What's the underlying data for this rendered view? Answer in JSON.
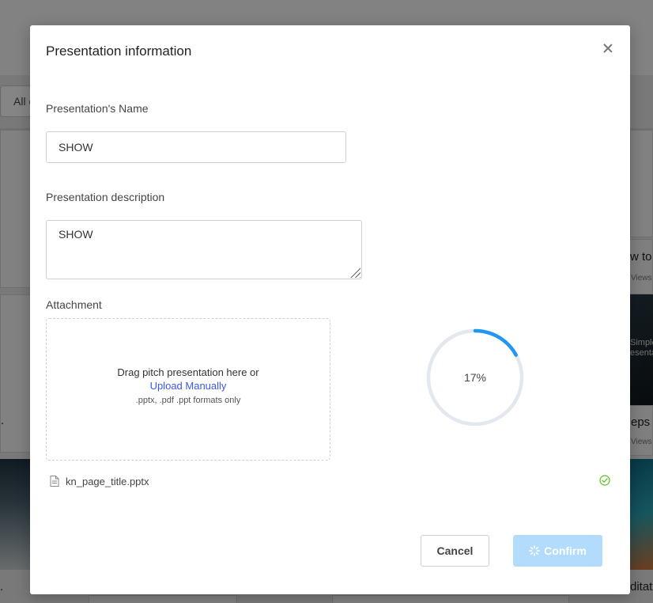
{
  "background": {
    "filter_label": "All c",
    "card_titles": [
      "w to",
      "eps",
      "ditat"
    ],
    "card_meta": [
      "Views",
      "Views"
    ],
    "thumb_captions": [
      "Simple",
      "esenta"
    ]
  },
  "modal": {
    "title": "Presentation information",
    "name_label": "Presentation's Name",
    "name_value": "SHOW",
    "description_label": "Presentation description",
    "description_value": "SHOW",
    "attachment_label": "Attachment",
    "dropzone": {
      "prompt": "Drag pitch presentation here or",
      "link": "Upload Manually",
      "hint": ".pptx, .pdf .ppt formats only"
    },
    "upload_progress": {
      "percent": 17,
      "label": "17%",
      "track_color": "#e3e8ef",
      "fill_color": "#2196f3"
    },
    "file": {
      "name": "kn_page_title.pptx",
      "icon": "document-icon",
      "status_icon": "check-circle-icon",
      "status_color": "#52c41a"
    },
    "buttons": {
      "cancel": "Cancel",
      "confirm": "Confirm",
      "confirm_icon": "loading-spinner-icon"
    }
  },
  "colors": {
    "link": "#3a57e8",
    "confirm_disabled": "#b3dbfb",
    "overlay": "rgba(0,0,0,0.48)"
  }
}
